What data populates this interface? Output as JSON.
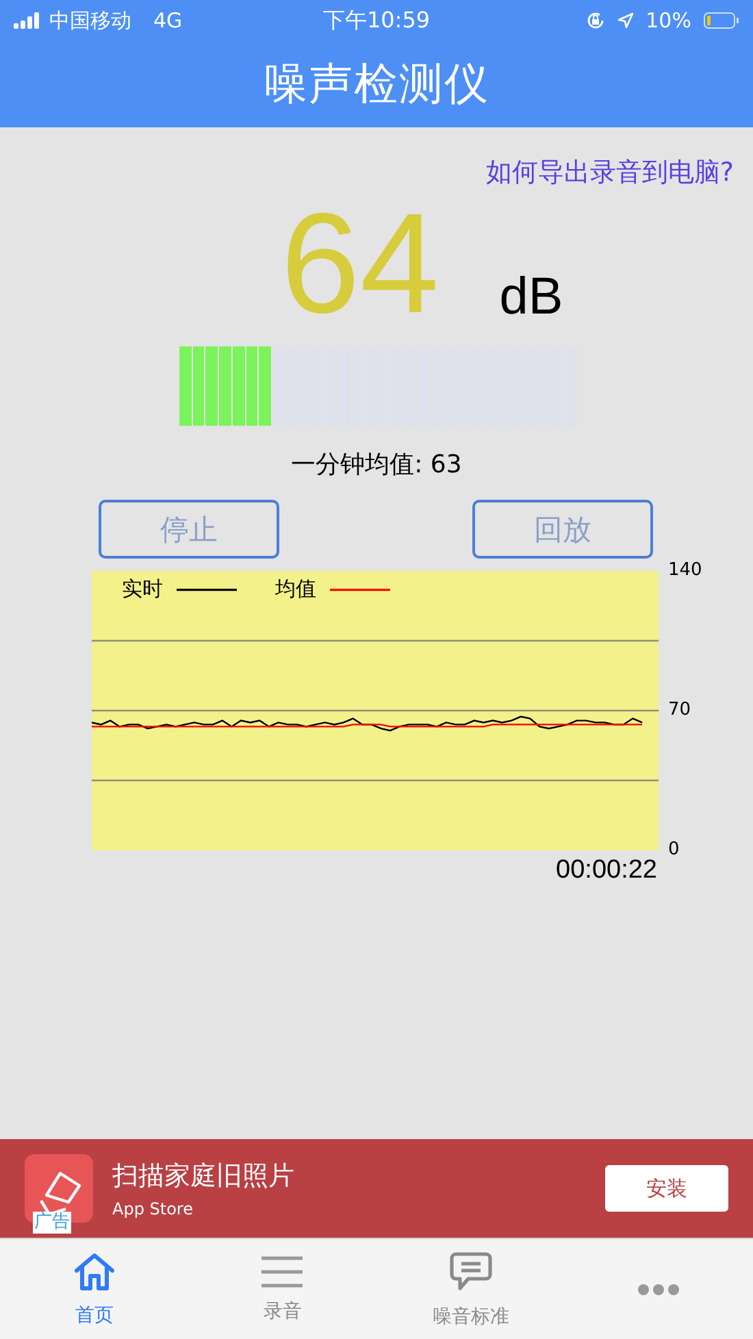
{
  "status_bar": {
    "carrier": "中国移动",
    "network": "4G",
    "time": "下午10:59",
    "battery_text": "10%"
  },
  "header": {
    "title": "噪声检测仪"
  },
  "help_link": "如何导出录音到电脑?",
  "reading": {
    "value": "64",
    "unit": "dB"
  },
  "meter": {
    "level": 0.2333
  },
  "average": "一分钟均值: 63",
  "buttons": [
    {
      "label": "停止"
    },
    {
      "label": "回放"
    }
  ],
  "chart": {
    "chart_data": {
      "type": "line",
      "legend": true,
      "ylim": [
        0,
        140
      ],
      "yticks": [
        0,
        70,
        140
      ],
      "series": [
        {
          "name": "实时",
          "color": "#000000",
          "values": [
            64,
            63,
            65,
            62,
            63,
            63,
            61,
            62,
            63,
            62,
            63,
            64,
            63,
            63,
            65,
            62,
            65,
            64,
            65,
            62,
            64,
            63,
            63,
            62,
            63,
            64,
            63,
            64,
            66,
            63,
            63,
            61,
            60,
            62,
            63,
            63,
            63,
            62,
            64,
            63,
            63,
            65,
            64,
            65,
            64,
            65,
            67,
            66,
            62,
            61,
            62,
            63,
            65,
            65,
            64,
            64,
            63,
            63,
            66,
            64
          ]
        },
        {
          "name": "均值",
          "color": "#ff0000",
          "values": [
            62,
            62,
            62,
            62,
            62,
            62,
            62,
            62,
            62,
            62,
            62,
            62,
            62,
            62,
            62,
            62,
            62,
            62,
            62,
            62,
            62,
            62,
            62,
            62,
            62,
            62,
            62,
            62,
            63,
            63,
            63,
            63,
            62,
            62,
            62,
            62,
            62,
            62,
            62,
            62,
            62,
            62,
            62,
            63,
            63,
            63,
            63,
            63,
            63,
            63,
            63,
            63,
            63,
            63,
            63,
            63,
            63,
            63,
            63,
            63
          ]
        }
      ]
    },
    "elapsed": "00:00:22"
  },
  "ad": {
    "badge": "广告",
    "title": "扫描家庭旧照片",
    "subtitle": "App Store",
    "button": "安装"
  },
  "tabs": [
    {
      "kind": "home",
      "label": "首页",
      "selected": true
    },
    {
      "kind": "list",
      "label": "录音",
      "selected": false
    },
    {
      "kind": "chat",
      "label": "噪音标准",
      "selected": false
    },
    {
      "kind": "more",
      "selected": false
    }
  ]
}
